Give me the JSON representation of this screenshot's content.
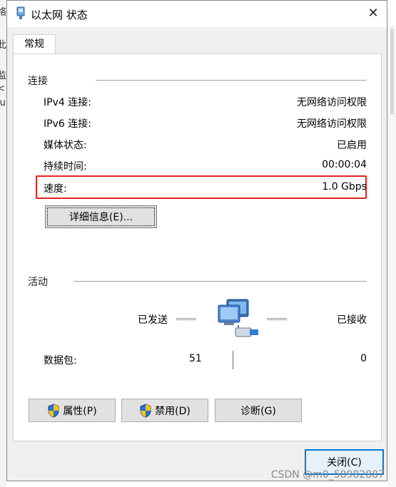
{
  "window": {
    "title": "以太网 状态",
    "close_icon": "close-icon"
  },
  "tab": {
    "label": "常规"
  },
  "connection": {
    "section_title": "连接",
    "rows": [
      {
        "label": "IPv4 连接:",
        "value": "无网络访问权限"
      },
      {
        "label": "IPv6 连接:",
        "value": "无网络访问权限"
      },
      {
        "label": "媒体状态:",
        "value": "已启用"
      },
      {
        "label": "持续时间:",
        "value": "00:00:04"
      },
      {
        "label": "速度:",
        "value": "1.0 Gbps"
      }
    ],
    "details_button": "详细信息(E)..."
  },
  "activity": {
    "section_title": "活动",
    "sent_label": "已发送",
    "received_label": "已接收",
    "packets_label": "数据包:",
    "packets_sent": "51",
    "packets_received": "0"
  },
  "buttons": {
    "properties": "属性(P)",
    "disable": "禁用(D)",
    "diagnose": "诊断(G)",
    "close": "关闭(C)"
  },
  "background": {
    "left_chars": [
      "络",
      "此",
      "监",
      "<",
      "lu"
    ]
  },
  "watermark": "CSDN @m0_58982887",
  "colors": {
    "highlight": "#e2241b",
    "accent": "#0078d7"
  }
}
